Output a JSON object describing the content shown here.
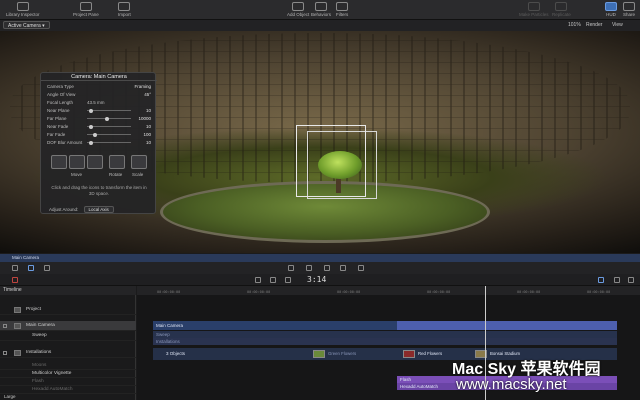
{
  "toolbar": {
    "library_inspector": "Library Inspector",
    "project_pane": "Project Pane",
    "import": "Import",
    "add_object": "Add Object",
    "behaviors": "Behaviors",
    "filters": "Filters",
    "make_particles": "Make Particles",
    "replicate": "Replicate",
    "hud": "HUD",
    "share": "Share"
  },
  "canvas_bar": {
    "camera_menu": "Active Camera",
    "zoom": "101%",
    "render": "Render",
    "view": "View"
  },
  "hud": {
    "title": "Camera: Main Camera",
    "rows": [
      {
        "label": "Camera Type",
        "value": "Framing"
      },
      {
        "label": "Angle Of View",
        "value": "45°"
      },
      {
        "label": "Focal Length",
        "value": "43.5 mm"
      },
      {
        "label": "Near Plane",
        "value": "10"
      },
      {
        "label": "Far Plane",
        "value": "10000"
      },
      {
        "label": "Near Fade",
        "value": "10"
      },
      {
        "label": "Far Fade",
        "value": "100"
      },
      {
        "label": "DOF Blur Amount",
        "value": "10"
      }
    ],
    "move": "Move",
    "rotate": "Rotate",
    "scale": "Scale",
    "help": "Click and drag the icons to transform the item in 3D space.",
    "adjust_label": "Adjust Around:",
    "adjust_value": "Local Axis"
  },
  "strip": {
    "label": "Main Camera"
  },
  "transport": {
    "timecode": "3:14"
  },
  "timeline": {
    "header": "Timeline",
    "layers": [
      {
        "name": "Project"
      },
      {
        "name": "Main Camera"
      },
      {
        "name": "Sweep"
      },
      {
        "name": "Installations"
      },
      {
        "name": "Moons"
      },
      {
        "name": "Multicolor Vignette"
      },
      {
        "name": "Flash"
      },
      {
        "name": "Hexadd AutoMatch"
      }
    ],
    "size_menu": "Large",
    "bars": {
      "main_camera": "Main Camera",
      "sweep": "Sweep",
      "installations": "Installations",
      "objects": "3 Objects",
      "clip_green": "Green Flowers",
      "clip_red": "Red Flowers",
      "clip_bonsai": "Bonsai Stadium",
      "flash": "Flash",
      "hexadd": "Hexadd AutoMatch"
    }
  },
  "watermark": {
    "line1": "Mac Sky 苹果软件园",
    "line2": "www.macsky.net"
  }
}
